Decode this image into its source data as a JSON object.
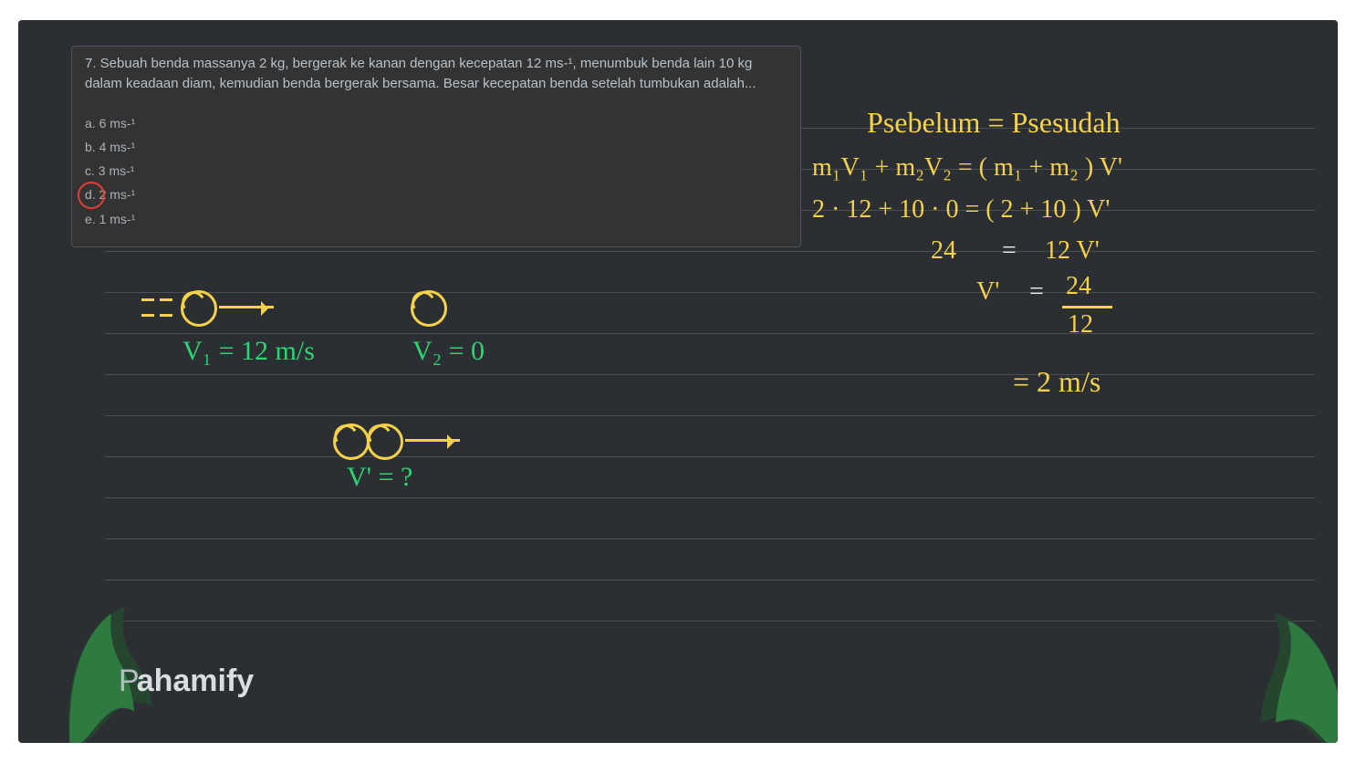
{
  "question": {
    "text": "7. Sebuah benda massanya 2 kg, bergerak ke kanan dengan kecepatan 12 ms-¹, menumbuk benda lain 10 kg dalam keadaan diam, kemudian benda bergerak bersama. Besar kecepatan benda setelah tumbukan adalah...",
    "options": {
      "a": "a. 6 ms-¹",
      "b": "b. 4 ms-¹",
      "c": "c. 3 ms-¹",
      "d": "d. 2 ms-¹",
      "e": "e. 1 ms-¹"
    },
    "circled": "d"
  },
  "diagram_labels": {
    "v1": "V₁ = 12 m/s",
    "v2": "V₂ = 0",
    "vq": "V' = ?"
  },
  "work": {
    "l1": "Psebelum = Psesudah",
    "l2": "m₁V₁ + m₂V₂  =  ( m₁ + m₂ ) V'",
    "l3": "2 · 12 + 10 · 0   =  ( 2 + 10 ) V'",
    "l4_left": "24",
    "l4_eq": "=",
    "l4_right": "12 V'",
    "l5_left": "V'",
    "l5_eq": "=",
    "l5_num": "24",
    "l5_den": "12",
    "l6": "= 2 m/s"
  },
  "brand": "ahamify"
}
